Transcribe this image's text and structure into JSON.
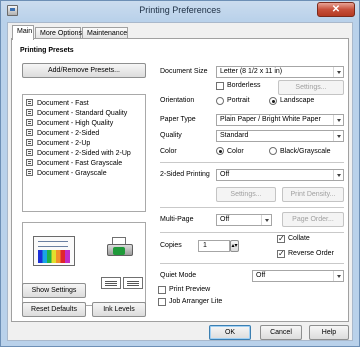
{
  "window": {
    "title": "Printing Preferences",
    "close_label": "✕"
  },
  "tabs": [
    "Main",
    "More Options",
    "Maintenance"
  ],
  "presets": {
    "heading": "Printing Presets",
    "add_remove_label": "Add/Remove Presets...",
    "items": [
      "Document - Fast",
      "Document - Standard Quality",
      "Document - High Quality",
      "Document - 2-Sided",
      "Document - 2-Up",
      "Document - 2-Sided with 2-Up",
      "Document - Fast Grayscale",
      "Document - Grayscale"
    ]
  },
  "left_buttons": {
    "show_settings": "Show Settings",
    "reset_defaults": "Reset Defaults",
    "ink_levels": "Ink Levels"
  },
  "settings": {
    "document_size_label": "Document Size",
    "document_size_value": "Letter (8 1/2 x 11 in)",
    "borderless_label": "Borderless",
    "borderless_checked": false,
    "borderless_settings_label": "Settings...",
    "orientation_label": "Orientation",
    "portrait_label": "Portrait",
    "landscape_label": "Landscape",
    "orientation_selected": "Landscape",
    "paper_type_label": "Paper Type",
    "paper_type_value": "Plain Paper / Bright White Paper",
    "quality_label": "Quality",
    "quality_value": "Standard",
    "color_label": "Color",
    "color_option_label": "Color",
    "grayscale_option_label": "Black/Grayscale",
    "color_selected": "Color",
    "two_sided_label": "2-Sided Printing",
    "two_sided_value": "Off",
    "two_sided_settings_label": "Settings...",
    "print_density_label": "Print Density...",
    "multipage_label": "Multi-Page",
    "multipage_value": "Off",
    "page_order_label": "Page Order...",
    "copies_label": "Copies",
    "copies_value": "1",
    "collate_label": "Collate",
    "collate_checked": true,
    "reverse_order_label": "Reverse Order",
    "reverse_order_checked": true,
    "quiet_mode_label": "Quiet Mode",
    "quiet_mode_value": "Off",
    "print_preview_label": "Print Preview",
    "print_preview_checked": false,
    "job_arranger_label": "Job Arranger Lite",
    "job_arranger_checked": false
  },
  "footer": {
    "ok": "OK",
    "cancel": "Cancel",
    "help": "Help"
  }
}
